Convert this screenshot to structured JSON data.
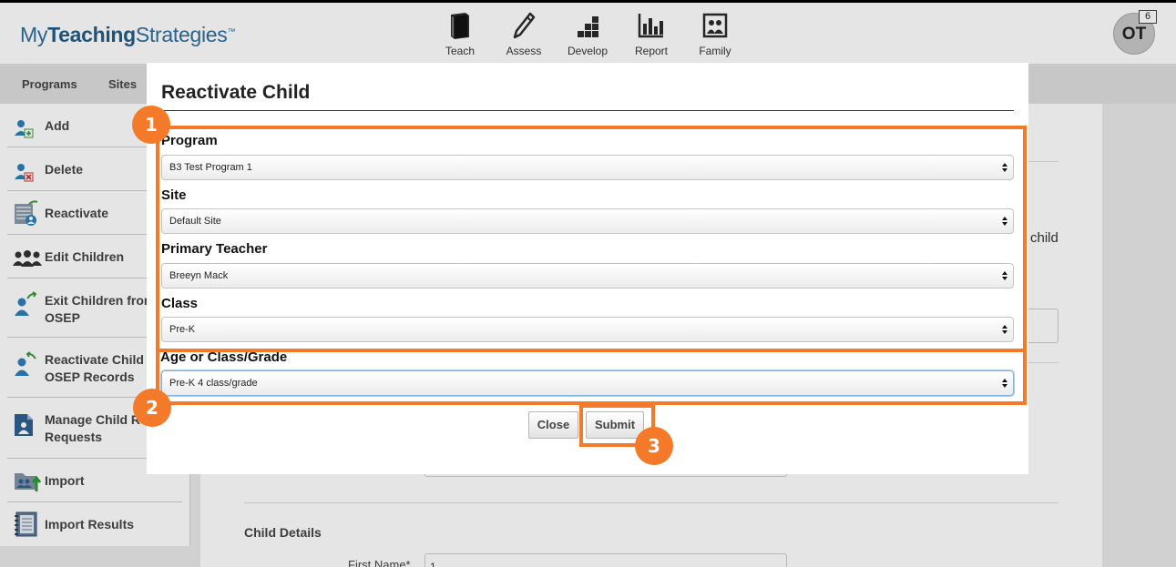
{
  "header": {
    "logo_prefix": "My",
    "logo_bold": "Teaching",
    "logo_suffix": "Strategies",
    "logo_tm": "™",
    "nav": [
      {
        "label": "Teach",
        "icon": "book-icon"
      },
      {
        "label": "Assess",
        "icon": "pencil-icon"
      },
      {
        "label": "Develop",
        "icon": "blocks-icon"
      },
      {
        "label": "Report",
        "icon": "bar-chart-icon"
      },
      {
        "label": "Family",
        "icon": "family-photo-icon"
      }
    ],
    "user_initials": "OT",
    "notification_count": "6"
  },
  "subnav": {
    "items": [
      "Programs",
      "Sites"
    ]
  },
  "sidebar": {
    "items": [
      {
        "label": "Add",
        "icon": "add-user-icon"
      },
      {
        "label": "Delete",
        "icon": "delete-user-icon"
      },
      {
        "label": "Reactivate",
        "icon": "reactivate-icon"
      },
      {
        "label": "Edit Children",
        "icon": "group-icon"
      },
      {
        "label": "Exit Children from\nOSEP",
        "icon": "exit-user-icon"
      },
      {
        "label": "Reactivate Child\nOSEP Records",
        "icon": "reactivate-user-icon"
      },
      {
        "label": "Manage Child Re\nRequests",
        "icon": "manage-requests-icon"
      },
      {
        "label": "Import",
        "icon": "import-folder-icon"
      },
      {
        "label": "Import Results",
        "icon": "notebook-icon"
      }
    ]
  },
  "content": {
    "partial_text": "child",
    "section_title": "Child Details",
    "first_name_label": "First Name*",
    "first_name_value": "1"
  },
  "modal": {
    "title": "Reactivate Child",
    "fields": [
      {
        "label": "Program",
        "value": "B3 Test Program 1"
      },
      {
        "label": "Site",
        "value": "Default Site"
      },
      {
        "label": "Primary Teacher",
        "value": "Breeyn Mack"
      },
      {
        "label": "Class",
        "value": "Pre-K"
      },
      {
        "label": "Age or Class/Grade",
        "value": "Pre-K 4 class/grade"
      }
    ],
    "close_label": "Close",
    "submit_label": "Submit"
  },
  "annotations": {
    "marker_1": "1",
    "marker_2": "2",
    "marker_3": "3",
    "color": "#f47a2a"
  },
  "colors": {
    "brand_blue": "#2e6f9e",
    "focus_blue": "#7fb2e5"
  }
}
